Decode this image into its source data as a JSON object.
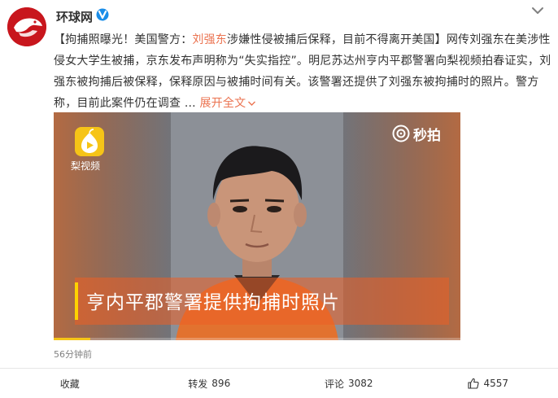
{
  "header": {
    "username": "环球网"
  },
  "post": {
    "segments": {
      "s1": "【拘捕照曝光！美国警方：",
      "s2": "刘强东",
      "s3": "涉嫌性侵被捕后保释，目前不得离开美国】网传刘强东在美涉性侵女大学生被捕，京东发布声明称为“失实指控”。明尼苏达州亨内平郡警署向梨视频拍春证实，刘强东被拘捕后被保释，保释原因与被捕时间有关。该警署还提供了刘强东被拘捕时的照片。警方称，目前此案件仍在调查",
      "s4": " ... ",
      "expand": "展开全文"
    },
    "timestamp": "56分钟前"
  },
  "video": {
    "source_label": "梨视频",
    "platform_label": "秒拍",
    "caption": "亨内平郡警署提供拘捕时照片",
    "progress": 0.09
  },
  "footer": {
    "favorite": "收藏",
    "repost_label": "转发",
    "repost_count": "896",
    "comment_label": "评论",
    "comment_count": "3082",
    "like_count": "4557"
  },
  "colors": {
    "accent": "#eb7350",
    "brand_red": "#c8161d",
    "pear_yellow": "#f6c417",
    "caption_accent": "#ffd200"
  },
  "icons": [
    "logo-avatar",
    "verified-badge",
    "chevron-down-icon",
    "pear-video-icon",
    "miaopai-icon",
    "like-icon"
  ]
}
